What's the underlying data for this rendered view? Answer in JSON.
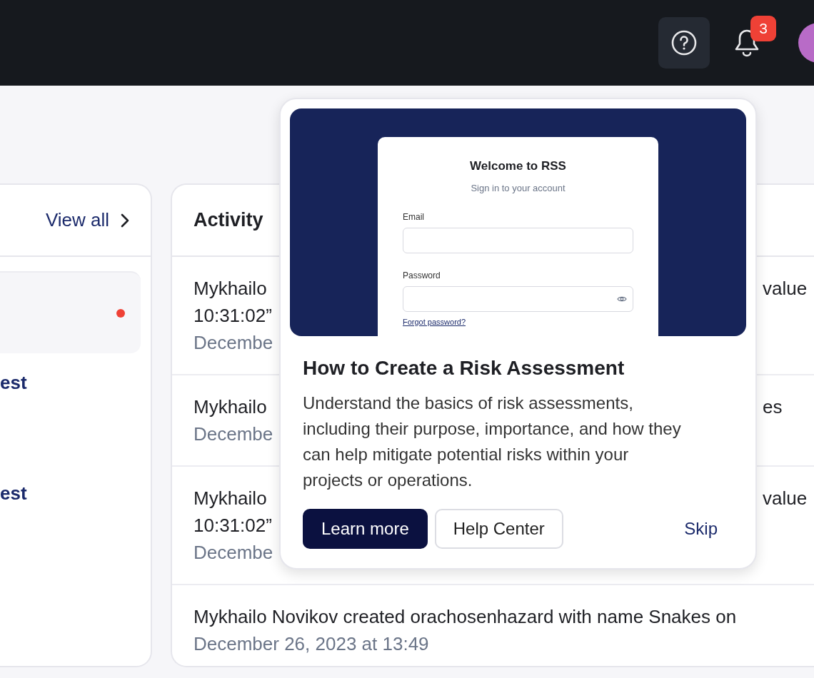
{
  "topbar": {
    "notification_count": "3"
  },
  "left_card": {
    "link": "View all",
    "items": [
      {
        "kind": "highlight",
        "unread": true
      },
      {
        "kind": "text",
        "text": "est"
      },
      {
        "kind": "text",
        "text": "est"
      }
    ]
  },
  "activity": {
    "title": "Activity",
    "rows": [
      {
        "lines": [
          "Mykhailo",
          "10:31:02”"
        ],
        "trailing": "value",
        "date": "Decembe"
      },
      {
        "lines": [
          "Mykhailo"
        ],
        "trailing": "es",
        "date": "Decembe"
      },
      {
        "lines": [
          "Mykhailo",
          "10:31:02”"
        ],
        "trailing": "value",
        "date": "Decembe"
      },
      {
        "lines": [
          "Mykhailo Novikov created orachosenhazard with name Snakes on"
        ],
        "date": "December 26, 2023 at 13:49"
      }
    ]
  },
  "popover": {
    "preview": {
      "heading": "Welcome to RSS",
      "subheading": "Sign in to your account",
      "fields": [
        {
          "label": "Email",
          "kind": "text"
        },
        {
          "label": "Password",
          "kind": "password"
        }
      ],
      "link": "Forgot password?"
    },
    "title": "How to Create a Risk Assessment",
    "description": "Understand the basics of risk assessments, including their purpose, importance, and how they can help mitigate potential risks within your projects or operations.",
    "buttons": [
      {
        "label": "Learn more",
        "kind": "primary"
      },
      {
        "label": "Help Center",
        "kind": "outline"
      },
      {
        "label": "Skip",
        "kind": "link"
      }
    ]
  }
}
